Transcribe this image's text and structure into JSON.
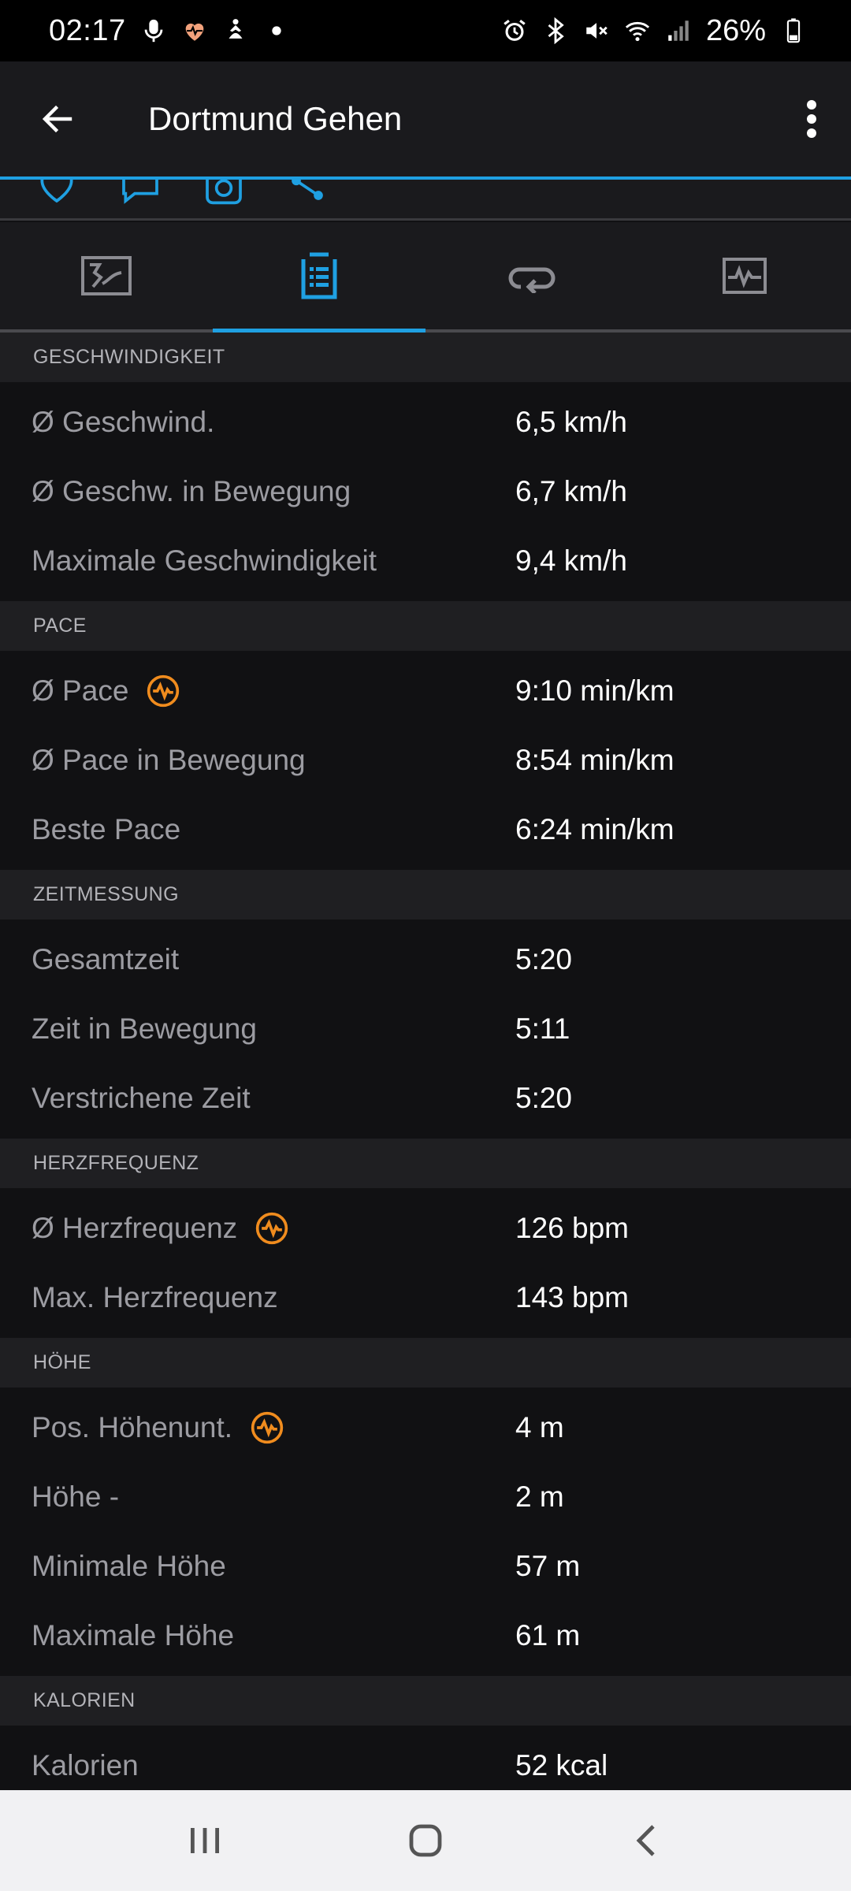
{
  "status_bar": {
    "time": "02:17",
    "battery_percent": "26%",
    "left_icons": [
      "mic-icon",
      "heart-icon",
      "yoga-icon",
      "dot-icon"
    ],
    "right_icons": [
      "alarm-icon",
      "bluetooth-icon",
      "mute-icon",
      "wifi-icon",
      "signal-icon",
      "battery-icon"
    ]
  },
  "app_bar": {
    "title": "Dortmund Gehen"
  },
  "colors": {
    "accent": "#1fa0e2",
    "badge": "#f08c1e",
    "background": "#111113",
    "section": "#1f1f22"
  },
  "tabs": [
    {
      "icon": "course-map-icon",
      "active": false
    },
    {
      "icon": "stats-document-icon",
      "active": true
    },
    {
      "icon": "laps-icon",
      "active": false
    },
    {
      "icon": "charts-icon",
      "active": false
    }
  ],
  "sections": [
    {
      "title": "GESCHWINDIGKEIT",
      "rows": [
        {
          "label": "Ø Geschwind.",
          "value": "6,5 km/h",
          "badge": false
        },
        {
          "label": "Ø Geschw. in Bewegung",
          "value": "6,7 km/h",
          "badge": false
        },
        {
          "label": "Maximale Geschwindigkeit",
          "value": "9,4 km/h",
          "badge": false
        }
      ]
    },
    {
      "title": "PACE",
      "rows": [
        {
          "label": "Ø Pace",
          "value": "9:10 min/km",
          "badge": true
        },
        {
          "label": "Ø Pace in Bewegung",
          "value": "8:54 min/km",
          "badge": false
        },
        {
          "label": "Beste Pace",
          "value": "6:24 min/km",
          "badge": false
        }
      ]
    },
    {
      "title": "ZEITMESSUNG",
      "rows": [
        {
          "label": "Gesamtzeit",
          "value": "5:20",
          "badge": false
        },
        {
          "label": "Zeit in Bewegung",
          "value": "5:11",
          "badge": false
        },
        {
          "label": "Verstrichene Zeit",
          "value": "5:20",
          "badge": false
        }
      ]
    },
    {
      "title": "HERZFREQUENZ",
      "rows": [
        {
          "label": "Ø Herzfrequenz",
          "value": "126 bpm",
          "badge": true
        },
        {
          "label": "Max. Herzfrequenz",
          "value": "143 bpm",
          "badge": false
        }
      ]
    },
    {
      "title": "HÖHE",
      "rows": [
        {
          "label": "Pos. Höhenunt.",
          "value": "4 m",
          "badge": true
        },
        {
          "label": "Höhe -",
          "value": "2 m",
          "badge": false
        },
        {
          "label": "Minimale Höhe",
          "value": "57 m",
          "badge": false
        },
        {
          "label": "Maximale Höhe",
          "value": "61 m",
          "badge": false
        }
      ]
    },
    {
      "title": "KALORIEN",
      "rows": [
        {
          "label": "Kalorien",
          "value": "52 kcal",
          "badge": false
        }
      ]
    }
  ],
  "nav_bar": {
    "buttons": [
      "recents-icon",
      "home-icon",
      "back-icon"
    ]
  }
}
